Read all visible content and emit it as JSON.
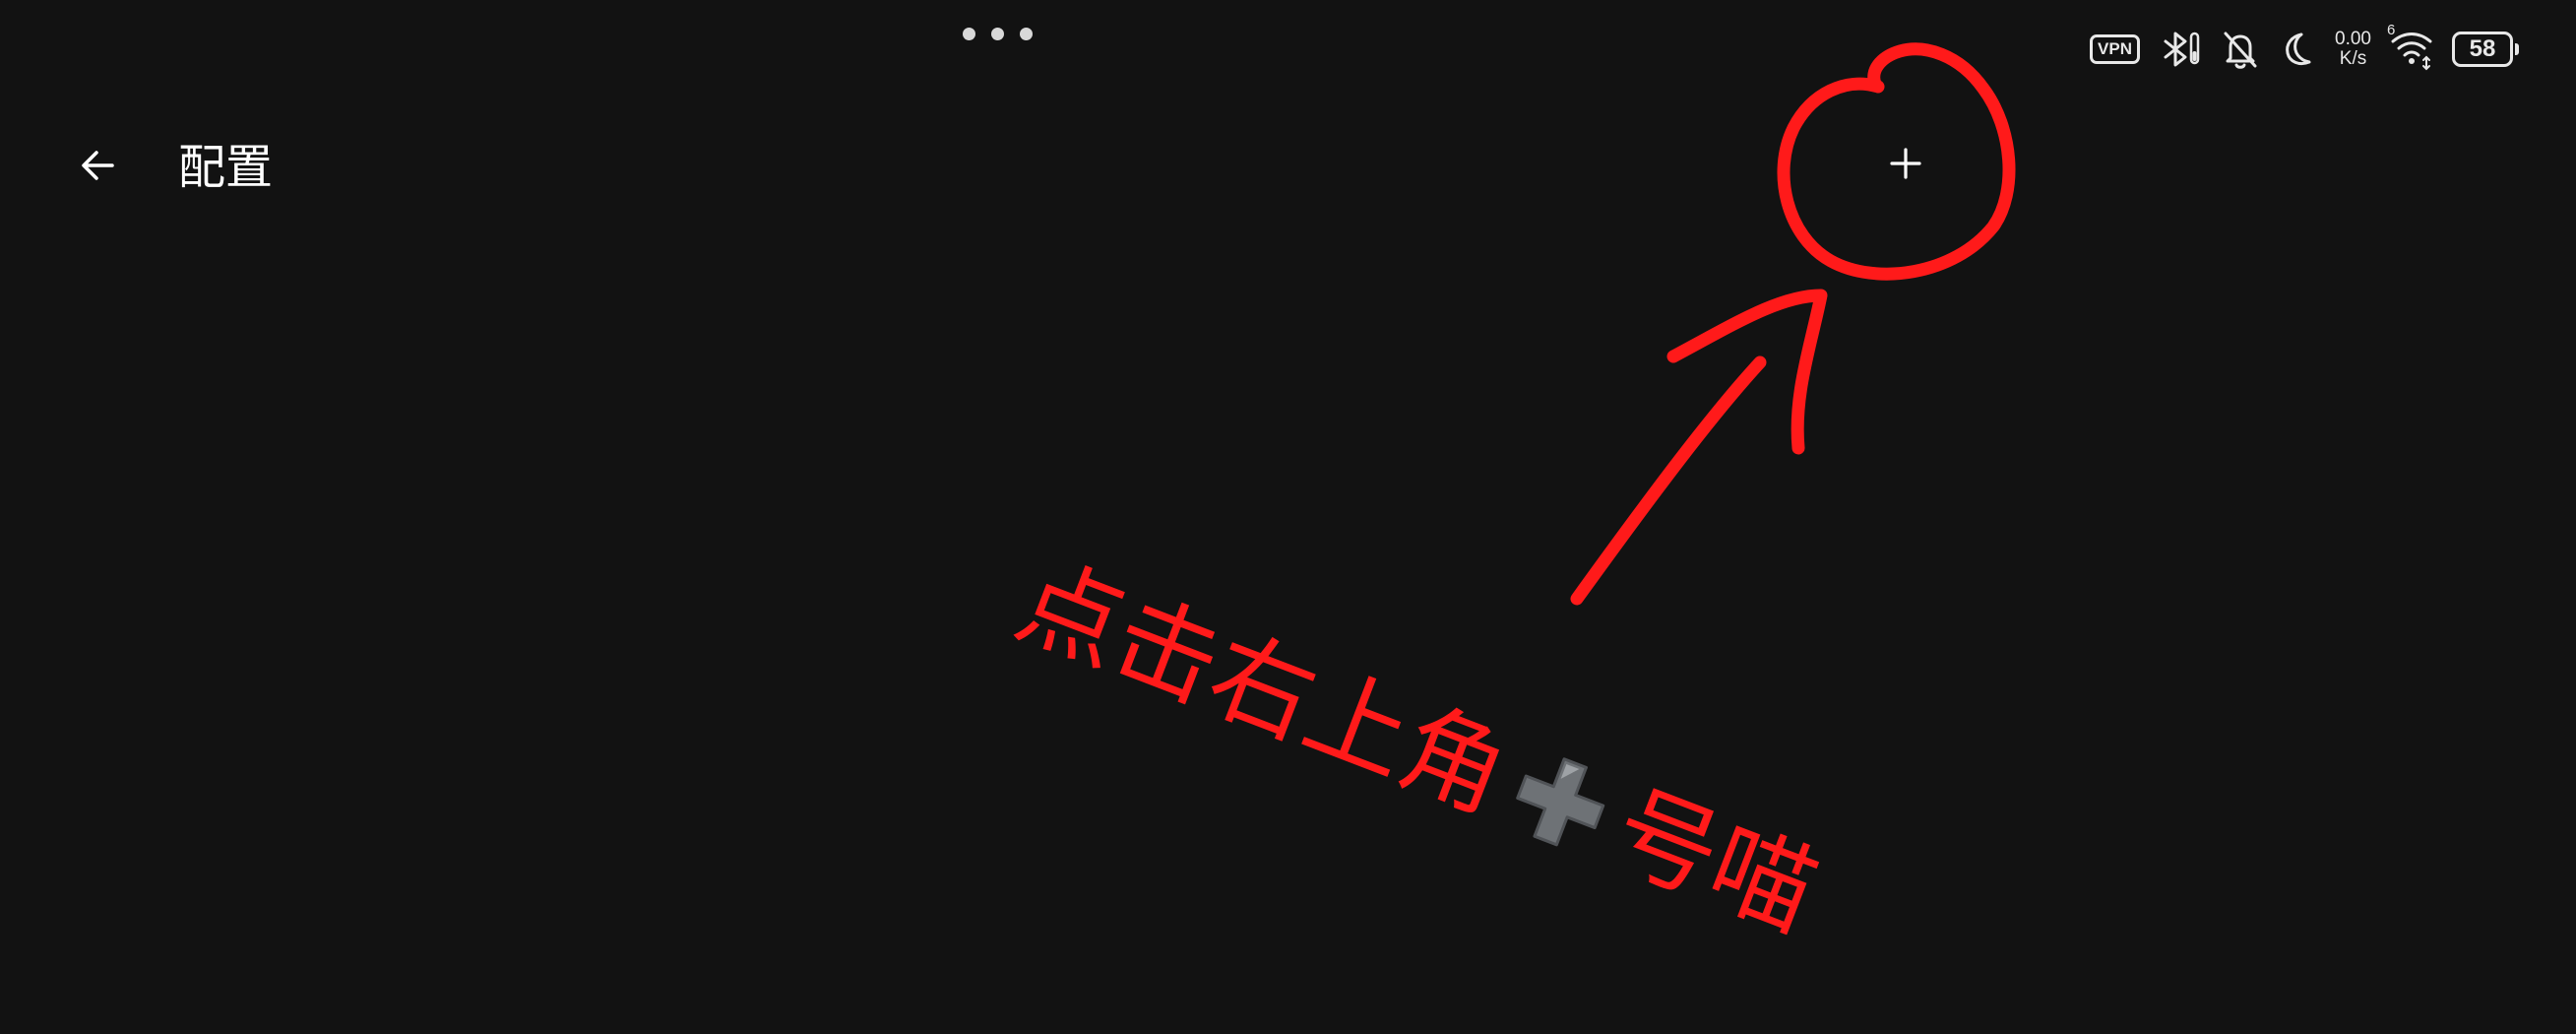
{
  "app_bar": {
    "title": "配置",
    "back_icon": "arrow-left-icon",
    "add_icon": "plus-icon",
    "add_symbol": "+"
  },
  "status_bar": {
    "vpn_label": "VPN",
    "net_speed_value": "0.00",
    "net_speed_unit": "K/s",
    "wifi_generation": "6",
    "battery_level": "58",
    "icons": [
      "vpn-icon",
      "bluetooth-icon",
      "bell-muted-icon",
      "moon-icon",
      "wifi-icon",
      "battery-icon"
    ]
  },
  "annotation": {
    "text_before": "点击右上角",
    "text_after": "号喵",
    "plus_emoji": "➕",
    "color": "#ff1a1a"
  },
  "colors": {
    "background": "#121212",
    "foreground": "#ffffff",
    "annotation": "#ff1a1a",
    "emoji_plus": "#6e7276"
  }
}
